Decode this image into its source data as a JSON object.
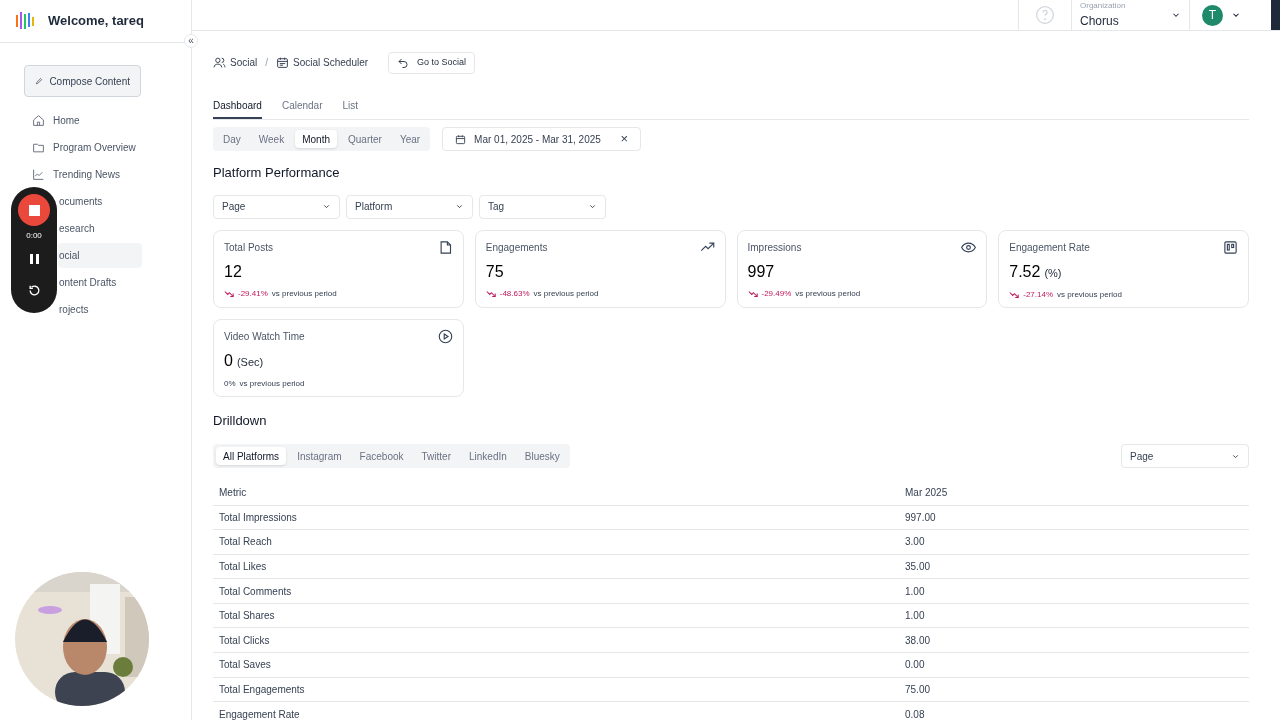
{
  "sidebar": {
    "welcome": "Welcome, tareq",
    "compose_button": "Compose Content",
    "collapse_glyph": "«",
    "items": [
      {
        "label": "Home",
        "selected": false
      },
      {
        "label": "Program Overview",
        "selected": false
      },
      {
        "label": "Trending News",
        "selected": false
      },
      {
        "label": "ocuments",
        "selected": false
      },
      {
        "label": "esearch",
        "selected": false
      },
      {
        "label": "ocial",
        "selected": true
      },
      {
        "label": "ontent Drafts",
        "selected": false
      },
      {
        "label": "rojects",
        "selected": false
      }
    ]
  },
  "recorder": {
    "time": "0:00"
  },
  "header": {
    "organization_label": "Organization",
    "organization": "Chorus",
    "avatar_letter": "T"
  },
  "breadcrumbs": [
    {
      "label": "Social"
    },
    {
      "label": "Social Scheduler"
    }
  ],
  "breadcrumb_separator": "/",
  "go_button": "Go to Social",
  "tabs": [
    {
      "label": "Dashboard",
      "selected": true
    },
    {
      "label": "Calendar",
      "selected": false
    },
    {
      "label": "List",
      "selected": false
    }
  ],
  "periods": [
    {
      "label": "Day",
      "selected": false
    },
    {
      "label": "Week",
      "selected": false
    },
    {
      "label": "Month",
      "selected": true
    },
    {
      "label": "Quarter",
      "selected": false
    },
    {
      "label": "Year",
      "selected": false
    }
  ],
  "date_range": "Mar 01, 2025 - Mar 31, 2025",
  "clear_glyph": "×",
  "section_title": "Platform Performance",
  "filters": [
    {
      "placeholder": "Page"
    },
    {
      "placeholder": "Platform"
    },
    {
      "placeholder": "Tag"
    }
  ],
  "cards": [
    {
      "title": "Total Posts",
      "value": "12",
      "change": "-29.41%",
      "declined": true,
      "compare": "vs previous period"
    },
    {
      "title": "Engagements",
      "value": "75",
      "change": "-48.63%",
      "declined": true,
      "compare": "vs previous period"
    },
    {
      "title": "Impressions",
      "value": "997",
      "change": "-29.49%",
      "declined": true,
      "compare": "vs previous period"
    },
    {
      "title": "Engagement Rate",
      "value": "7.52",
      "unit": "(%)",
      "change": "-27.14%",
      "declined": true,
      "compare": "vs previous period"
    },
    {
      "title": "Video Watch Time",
      "value": "0",
      "unit": "(Sec)",
      "change": "0%",
      "declined": false,
      "compare": "vs previous period"
    }
  ],
  "drilldown": {
    "title": "Drilldown",
    "platforms": [
      {
        "label": "All Platforms",
        "selected": true
      },
      {
        "label": "Instagram",
        "selected": false
      },
      {
        "label": "Facebook",
        "selected": false
      },
      {
        "label": "Twitter",
        "selected": false
      },
      {
        "label": "LinkedIn",
        "selected": false
      },
      {
        "label": "Bluesky",
        "selected": false
      }
    ],
    "page_select": "Page",
    "table": {
      "columns": [
        "Metric",
        "Mar 2025"
      ],
      "rows": [
        [
          "Total Impressions",
          "997.00"
        ],
        [
          "Total Reach",
          "3.00"
        ],
        [
          "Total Likes",
          "35.00"
        ],
        [
          "Total Comments",
          "1.00"
        ],
        [
          "Total Shares",
          "1.00"
        ],
        [
          "Total Clicks",
          "38.00"
        ],
        [
          "Total Saves",
          "0.00"
        ],
        [
          "Total Engagements",
          "75.00"
        ],
        [
          "Engagement Rate",
          "0.08"
        ]
      ]
    }
  }
}
